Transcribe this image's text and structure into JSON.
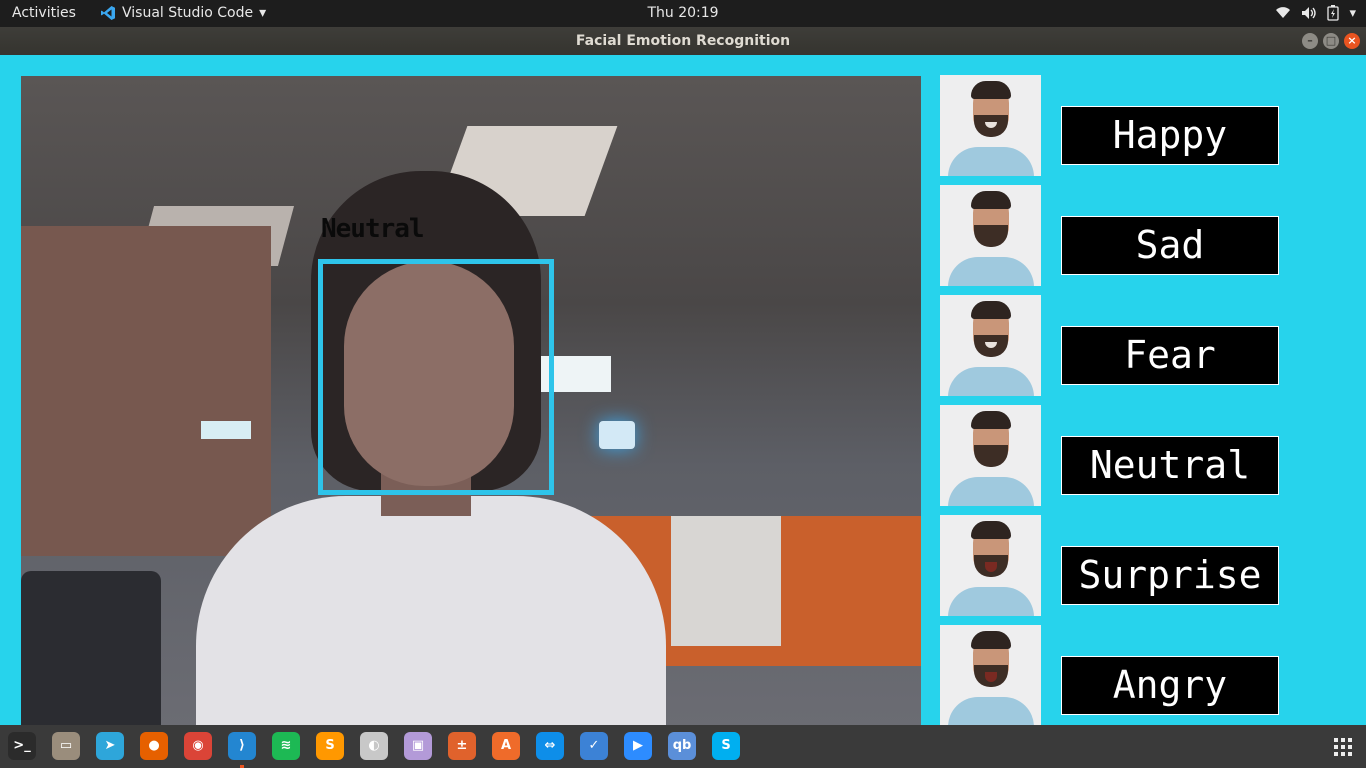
{
  "topbar": {
    "activities": "Activities",
    "app_name": "Visual Studio Code",
    "clock": "Thu 20:19"
  },
  "window": {
    "title": "Facial Emotion Recognition",
    "close_glyph": "×"
  },
  "detection": {
    "label": "Neutral",
    "box_color": "#2ec4ea"
  },
  "emotions": [
    {
      "label": "Happy"
    },
    {
      "label": "Sad"
    },
    {
      "label": "Fear"
    },
    {
      "label": "Neutral"
    },
    {
      "label": "Surprise"
    },
    {
      "label": "Angry"
    }
  ],
  "dock": {
    "apps": [
      {
        "name": "terminal-icon",
        "color": "#2b2b2b",
        "glyph": ">_"
      },
      {
        "name": "files-icon",
        "color": "#9a8d7c",
        "glyph": "▭"
      },
      {
        "name": "telegram-icon",
        "color": "#2ea6da",
        "glyph": "➤"
      },
      {
        "name": "firefox-icon",
        "color": "#e66000",
        "glyph": "●"
      },
      {
        "name": "chrome-icon",
        "color": "#db4437",
        "glyph": "◉"
      },
      {
        "name": "vscode-icon",
        "color": "#2386d1",
        "glyph": "⟩"
      },
      {
        "name": "spotify-icon",
        "color": "#1db954",
        "glyph": "≋"
      },
      {
        "name": "sublime-icon",
        "color": "#ff9800",
        "glyph": "S"
      },
      {
        "name": "media-player-icon",
        "color": "#c8c8c8",
        "glyph": "◐"
      },
      {
        "name": "screenshot-icon",
        "color": "#b39ad8",
        "glyph": "▣"
      },
      {
        "name": "calculator-icon",
        "color": "#e0622c",
        "glyph": "±"
      },
      {
        "name": "software-center-icon",
        "color": "#ef6b2a",
        "glyph": "A"
      },
      {
        "name": "teamviewer-icon",
        "color": "#0e8ee9",
        "glyph": "⇔"
      },
      {
        "name": "tasks-icon",
        "color": "#3c82d6",
        "glyph": "✓"
      },
      {
        "name": "zoom-icon",
        "color": "#2d8cff",
        "glyph": "▶"
      },
      {
        "name": "qbittorrent-icon",
        "color": "#5b8fd9",
        "glyph": "qb"
      },
      {
        "name": "skype-icon",
        "color": "#00aff0",
        "glyph": "S"
      }
    ],
    "active_index": 5
  },
  "colors": {
    "background": "#27d3ec",
    "accent": "#e95420"
  }
}
